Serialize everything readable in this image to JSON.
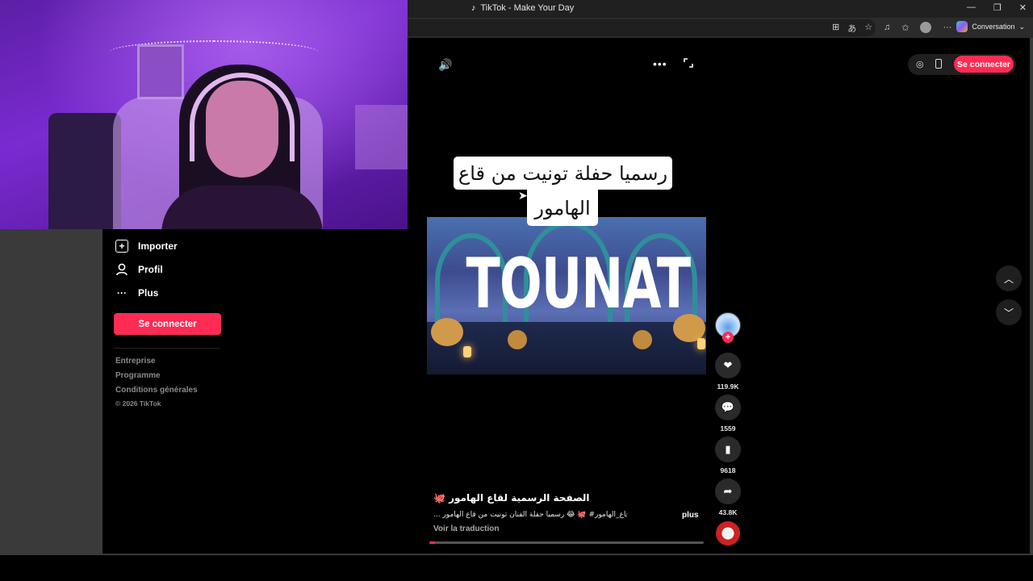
{
  "window": {
    "tab_title": "TikTok - Make Your Day",
    "copilot_label": "Conversation"
  },
  "sidebar": {
    "items": [
      {
        "label": "Importer",
        "icon": "upload-plus-icon"
      },
      {
        "label": "Profil",
        "icon": "person-icon"
      },
      {
        "label": "Plus",
        "icon": "more-dots-icon"
      }
    ],
    "login_label": "Se connecter",
    "footer_links": [
      "Entreprise",
      "Programme",
      "Conditions générales"
    ],
    "copyright": "© 2026 TikTok"
  },
  "header": {
    "login_label": "Se connecter"
  },
  "video": {
    "caption_line1": "رسميا حفلة تونيت من قاع",
    "caption_line2": "الهامور",
    "title_overlay": "TOUNAT",
    "progress": 0.02
  },
  "actions": {
    "likes": "119.9K",
    "comments": "1559",
    "saves": "9618",
    "shares": "43.8K"
  },
  "description": {
    "author": "الصفحة الرسمية لقاع الهامور 🐙",
    "text": "...  قاع_الهامور# 🐙 😂 رسميا حفلة الفنان تونيت من قاع الهامور",
    "more_label": "plus",
    "translate_label": "Voir la traduction"
  },
  "colors": {
    "accent": "#fe2c55",
    "background": "#000000",
    "muted_text": "#8a8a8a"
  }
}
